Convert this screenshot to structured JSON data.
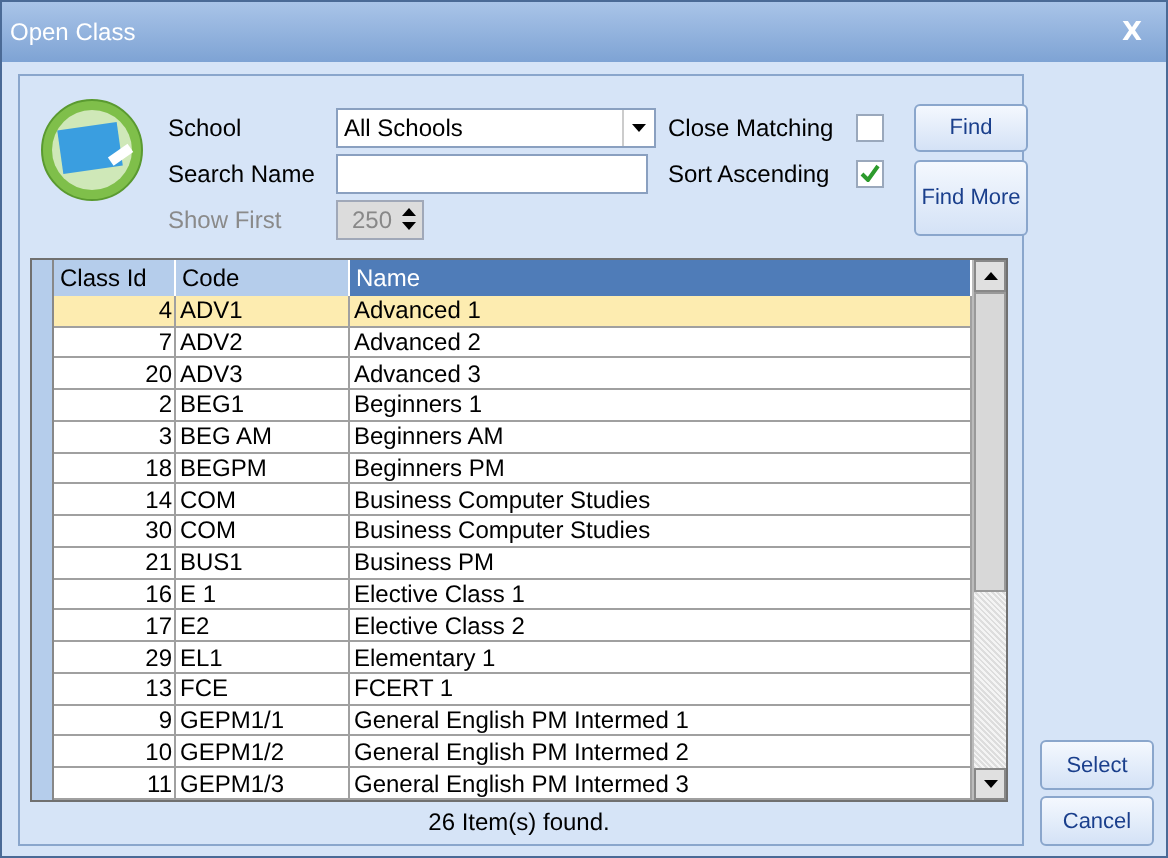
{
  "window": {
    "title": "Open Class",
    "close": "X"
  },
  "filters": {
    "school_label": "School",
    "school_value": "All Schools",
    "search_label": "Search Name",
    "show_first_label": "Show First",
    "show_first_value": "250",
    "show_first_disabled": true,
    "close_matching_label": "Close Matching",
    "close_matching_checked": false,
    "sort_ascending_label": "Sort Ascending",
    "sort_ascending_checked": true
  },
  "buttons": {
    "find": "Find",
    "find_more": "Find More",
    "select": "Select",
    "cancel": "Cancel"
  },
  "table": {
    "columns": [
      "Class Id",
      "Code",
      "Name"
    ],
    "rows": [
      {
        "cells": [
          "4",
          "ADV1",
          "Advanced 1"
        ],
        "selected": true
      },
      {
        "cells": [
          "7",
          "ADV2",
          "Advanced 2"
        ],
        "selected": false
      },
      {
        "cells": [
          "20",
          "ADV3",
          "Advanced 3"
        ],
        "selected": false
      },
      {
        "cells": [
          "2",
          "BEG1",
          "Beginners 1"
        ],
        "selected": false
      },
      {
        "cells": [
          "3",
          "BEG AM",
          "Beginners AM"
        ],
        "selected": false
      },
      {
        "cells": [
          "18",
          "BEGPM",
          "Beginners PM"
        ],
        "selected": false
      },
      {
        "cells": [
          "14",
          "COM",
          "Business Computer Studies"
        ],
        "selected": false
      },
      {
        "cells": [
          "30",
          "COM",
          "Business Computer Studies"
        ],
        "selected": false
      },
      {
        "cells": [
          "21",
          "BUS1",
          "Business PM"
        ],
        "selected": false
      },
      {
        "cells": [
          "16",
          "E 1",
          "Elective Class 1"
        ],
        "selected": false
      },
      {
        "cells": [
          "17",
          "E2",
          "Elective Class 2"
        ],
        "selected": false
      },
      {
        "cells": [
          "29",
          "EL1",
          "Elementary 1"
        ],
        "selected": false
      },
      {
        "cells": [
          "13",
          "FCE",
          "FCERT 1"
        ],
        "selected": false
      },
      {
        "cells": [
          "9",
          "GEPM1/1",
          "General English PM Intermed 1"
        ],
        "selected": false
      },
      {
        "cells": [
          "10",
          "GEPM1/2",
          "General English PM Intermed 2"
        ],
        "selected": false
      },
      {
        "cells": [
          "11",
          "GEPM1/3",
          "General English PM Intermed 3"
        ],
        "selected": false
      }
    ]
  },
  "status": "26 Item(s) found."
}
